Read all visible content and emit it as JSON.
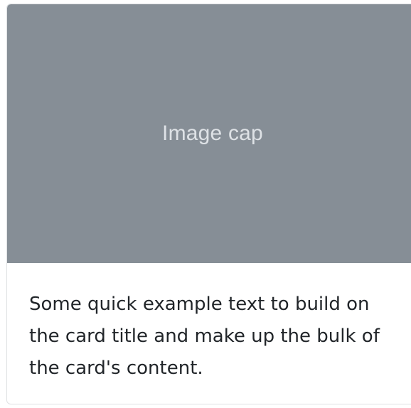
{
  "card": {
    "image_cap": "Image cap",
    "text": "Some quick example text to build on the card title and make up the bulk of the card's content."
  },
  "colors": {
    "image_background": "#868e96",
    "image_text": "#dee2e6",
    "body_text": "#212529",
    "border": "#dfe1e3"
  }
}
